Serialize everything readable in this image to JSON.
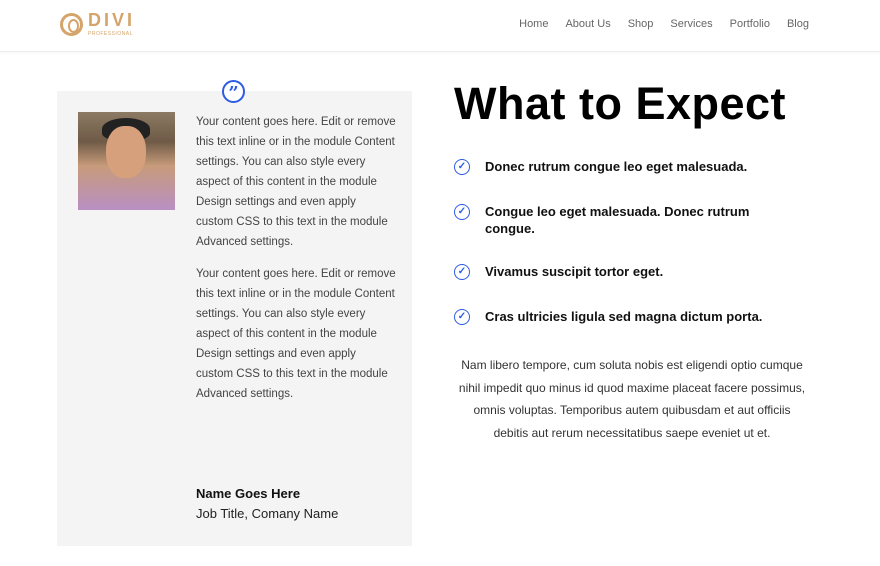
{
  "header": {
    "logo": "DIVI",
    "logo_sub": "PROFESSIONAL",
    "nav": [
      "Home",
      "About Us",
      "Shop",
      "Services",
      "Portfolio",
      "Blog"
    ]
  },
  "testimonial": {
    "paragraphs": [
      "Your content goes here. Edit or remove this text inline or in the module Content settings. You can also style every aspect of this content in the module Design settings and even apply custom CSS to this text in the module Advanced settings.",
      "Your content goes here. Edit or remove this text inline or in the module Content settings. You can also style every aspect of this content in the module Design settings and even apply custom CSS to this text in the module Advanced settings."
    ],
    "name": "Name Goes Here",
    "job": "Job Title, Comany Name",
    "quote_icon": "”"
  },
  "main": {
    "title": "What to Expect",
    "items": [
      "Donec rutrum congue leo eget malesuada.",
      "Congue leo eget malesuada. Donec rutrum congue.",
      "Vivamus suscipit tortor eget.",
      "Cras ultricies ligula sed magna dictum porta."
    ],
    "check_icon": "✓",
    "paragraph": "Nam libero tempore, cum soluta nobis est eligendi optio cumque nihil impedit quo minus id quod maxime placeat facere possimus, omnis voluptas. Temporibus autem quibusdam et aut officiis debitis aut rerum necessitatibus saepe eveniet ut et."
  },
  "colors": {
    "accent": "#2d5be3",
    "brand": "#d4a46a",
    "card": "#f4f4f4"
  }
}
